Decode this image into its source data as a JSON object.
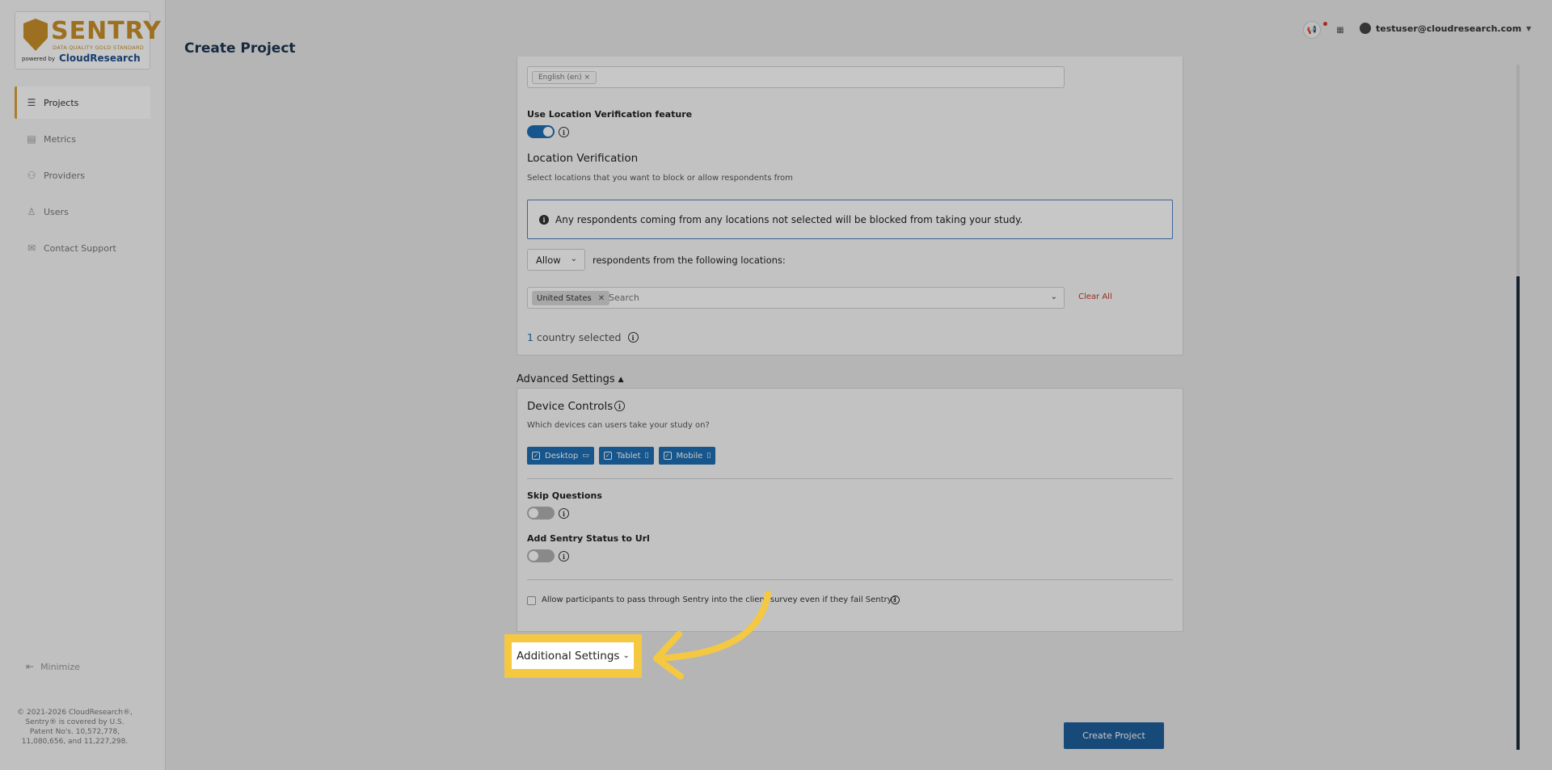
{
  "brand": {
    "name": "SENTRY",
    "tagline": "DATA QUALITY GOLD STANDARD",
    "powered_by": "powered by",
    "company": "CloudResearch",
    "accent": "#c8902a"
  },
  "sidebar": {
    "items": [
      {
        "label": "Projects",
        "icon": "list-icon",
        "active": true
      },
      {
        "label": "Metrics",
        "icon": "bar-chart-icon",
        "active": false
      },
      {
        "label": "Providers",
        "icon": "group-icon",
        "active": false
      },
      {
        "label": "Users",
        "icon": "user-icon",
        "active": false
      },
      {
        "label": "Contact Support",
        "icon": "mail-icon",
        "active": false
      }
    ],
    "minimize_label": "Minimize",
    "copyright": "© 2021-2026 CloudResearch®, Sentry® is covered by U.S. Patent No's. 10,572,778, 11,080,656, and 11,227,298."
  },
  "header": {
    "title": "Create Project",
    "user_email": "testuser@cloudresearch.com"
  },
  "form": {
    "language_chip": "English (en)",
    "location_feature_label": "Use Location Verification feature",
    "location_title": "Location Verification",
    "location_subtitle": "Select locations that you want to block or allow respondents from",
    "alert_text": "Any respondents coming from any locations not selected will be blocked from taking your study.",
    "mode_value": "Allow",
    "mode_suffix": "respondents from the following locations:",
    "selected_location": "United States",
    "search_placeholder": "Search",
    "clear_all": "Clear All",
    "count_number": "1",
    "count_text": "country selected",
    "advanced_label": "Advanced Settings",
    "device_title": "Device Controls",
    "device_subtitle": "Which devices can users take your study on?",
    "devices": [
      {
        "label": "Desktop",
        "icon": "desktop-icon"
      },
      {
        "label": "Tablet",
        "icon": "tablet-icon"
      },
      {
        "label": "Mobile",
        "icon": "mobile-icon"
      }
    ],
    "skip_label": "Skip Questions",
    "status_label": "Add Sentry Status to Url",
    "pass_through_label": "Allow participants to pass through Sentry into the client survey even if they fail Sentry?",
    "additional_label": "Additional Settings",
    "create_button": "Create Project"
  },
  "colors": {
    "primary": "#1d6fb5",
    "highlight": "#f5c842",
    "danger": "#c0392b"
  }
}
